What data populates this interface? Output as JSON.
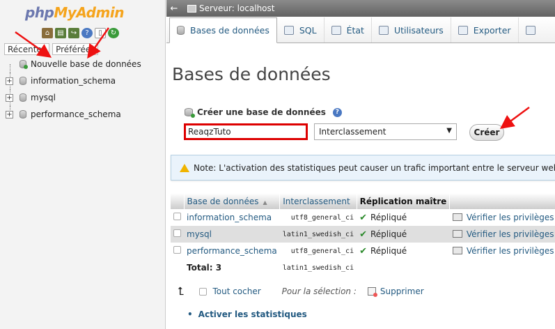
{
  "logo": {
    "php": "php",
    "admin": "MyAdmin"
  },
  "sidebar": {
    "icons": [
      "home-icon",
      "sql-icon",
      "exit-icon",
      "help-icon",
      "docs-icon",
      "reload-icon"
    ],
    "tabs": [
      "Récentes",
      "Préférées"
    ],
    "new_db": "Nouvelle base de données",
    "databases": [
      "information_schema",
      "mysql",
      "performance_schema"
    ]
  },
  "topbar": {
    "back": "←",
    "breadcrumb": "Serveur: localhost"
  },
  "tabs": [
    {
      "label": "Bases de données",
      "icon": "database-icon",
      "active": true
    },
    {
      "label": "SQL",
      "icon": "sql-icon"
    },
    {
      "label": "État",
      "icon": "status-icon"
    },
    {
      "label": "Utilisateurs",
      "icon": "users-icon"
    },
    {
      "label": "Exporter",
      "icon": "export-icon"
    },
    {
      "label": "",
      "icon": "import-icon"
    }
  ],
  "main": {
    "title": "Bases de données",
    "create_label": "Créer une base de données",
    "db_name_value": "ReaqzTuto",
    "collation_placeholder": "Interclassement",
    "create_button": "Créer",
    "notice": "Note: L'activation des statistiques peut causer un trafic important entre le serveur web et l"
  },
  "table": {
    "headers": [
      "Base de données",
      "Interclassement",
      "Réplication maître",
      ""
    ],
    "rows": [
      {
        "name": "information_schema",
        "collation": "utf8_general_ci",
        "replication": "Répliqué",
        "action": "Vérifier les privilèges"
      },
      {
        "name": "mysql",
        "collation": "latin1_swedish_ci",
        "replication": "Répliqué",
        "action": "Vérifier les privilèges"
      },
      {
        "name": "performance_schema",
        "collation": "utf8_general_ci",
        "replication": "Répliqué",
        "action": "Vérifier les privilèges"
      }
    ],
    "total_label": "Total: 3",
    "total_collation": "latin1_swedish_ci"
  },
  "bulk": {
    "check_all": "Tout cocher",
    "with_selected": "Pour la sélection :",
    "delete": "Supprimer"
  },
  "activate_stats": "Activer les statistiques",
  "colors": {
    "link": "#235a81",
    "highlight": "#dd0000",
    "annotation_arrow": "#ee1111"
  }
}
